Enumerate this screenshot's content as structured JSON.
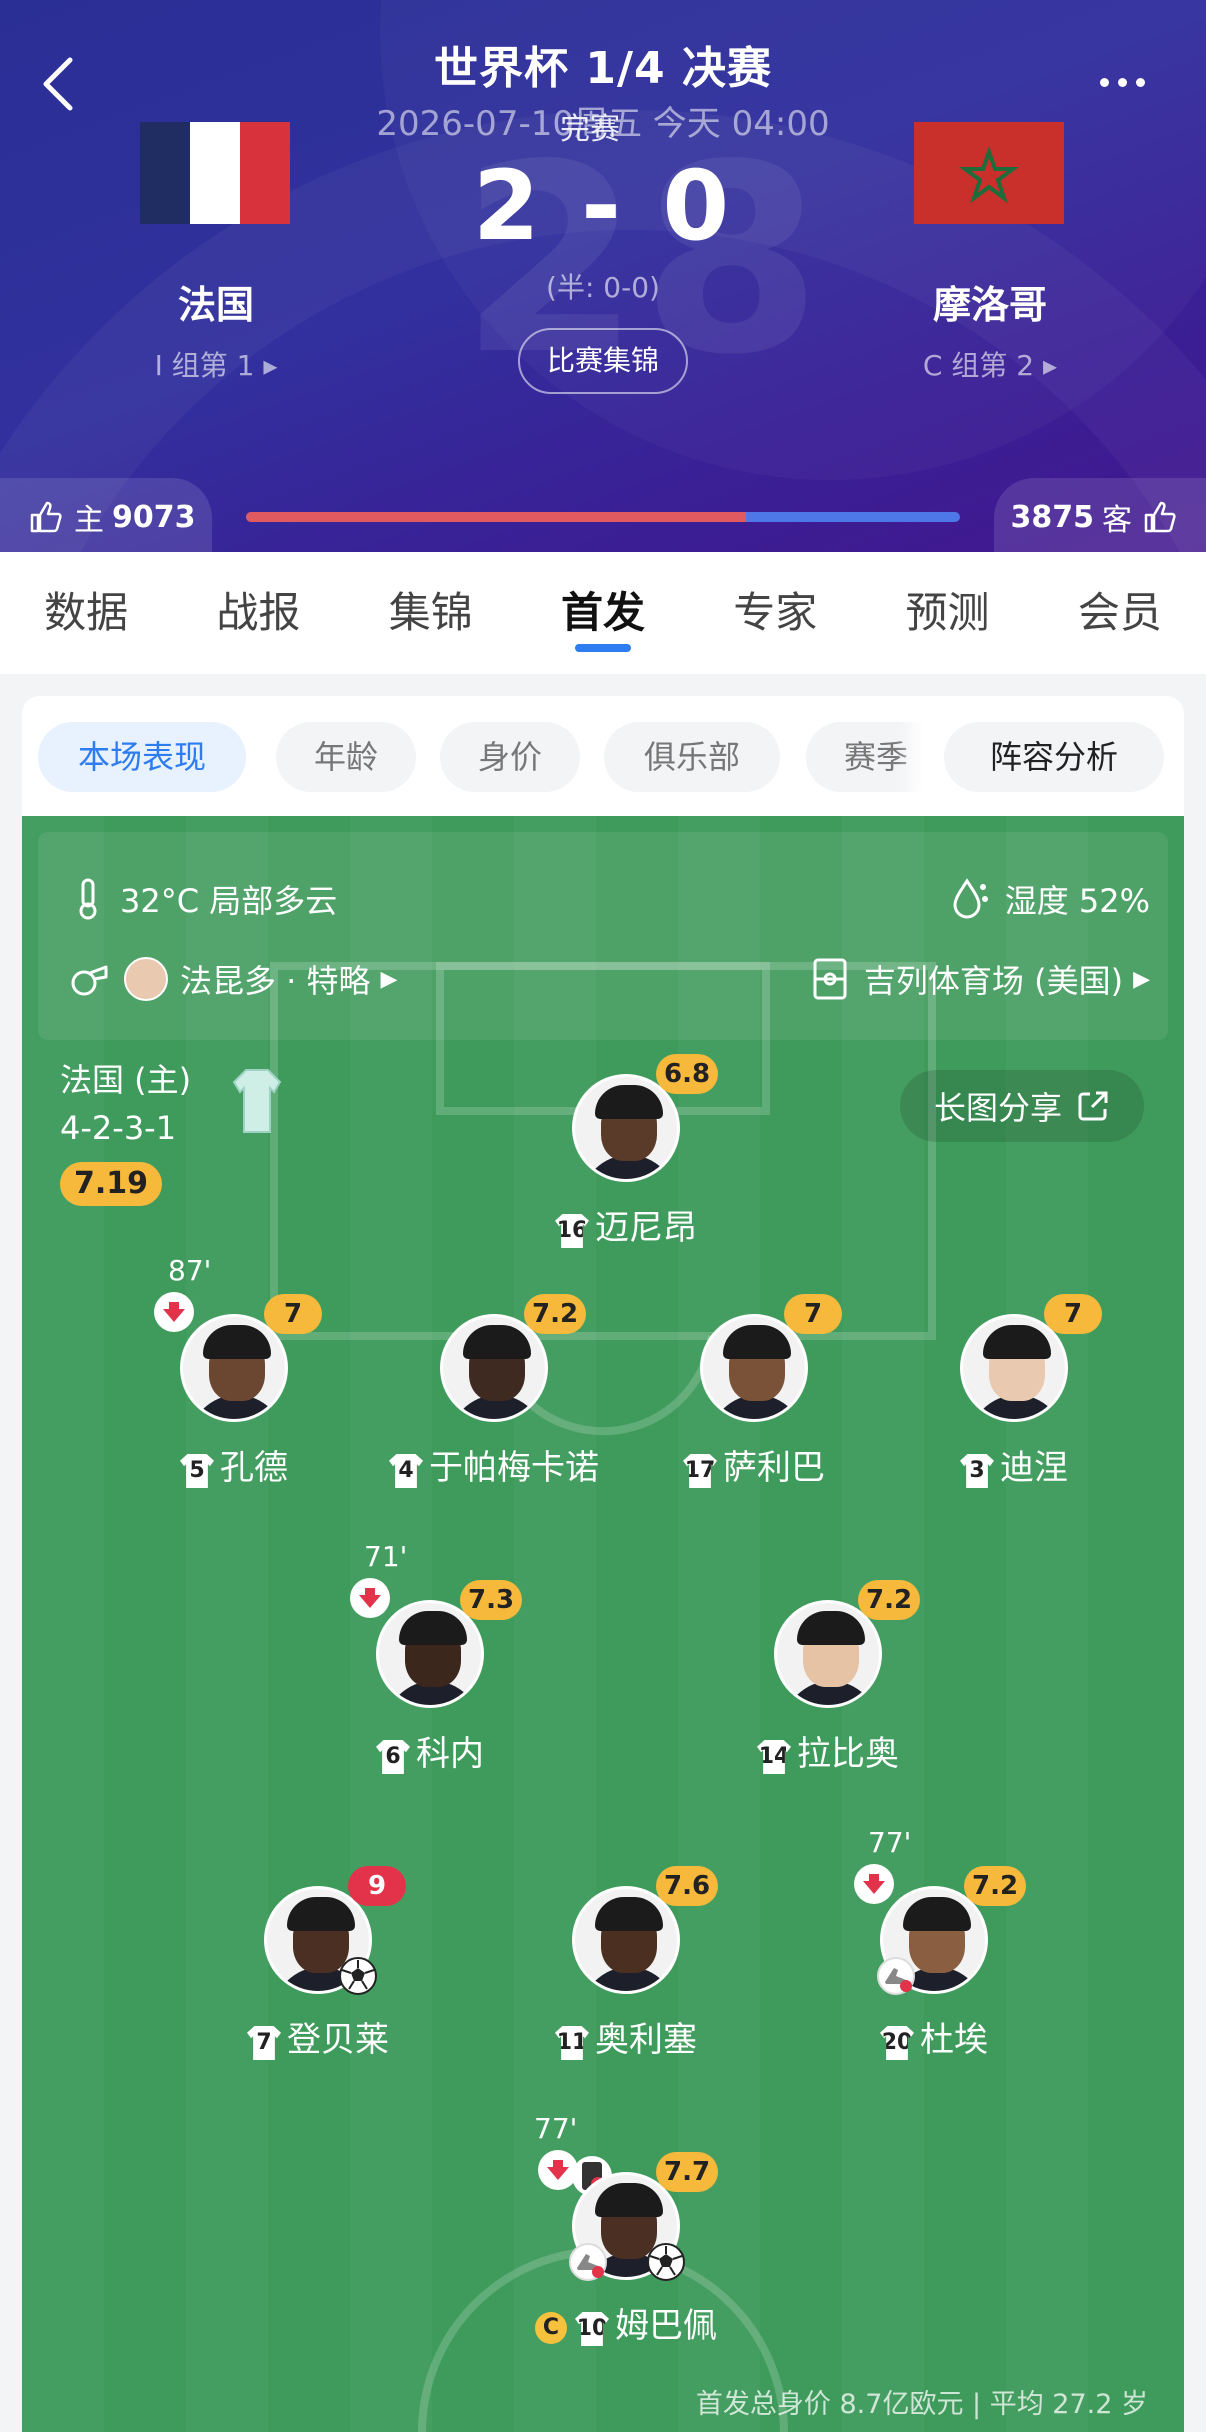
{
  "header": {
    "title": "世界杯 1/4 决赛",
    "datetime": "2026-07-10周五  今天 04:00",
    "status": "完赛",
    "score": "2 - 0",
    "halftime": "(半: 0-0)",
    "highlights_label": "比赛集锦",
    "home": {
      "name": "法国",
      "rank": "I 组第 1",
      "flag": "france-flag"
    },
    "away": {
      "name": "摩洛哥",
      "rank": "C 组第 2",
      "flag": "morocco-flag"
    }
  },
  "votes": {
    "home_label": "主",
    "home_count": "9073",
    "away_label": "客",
    "away_count": "3875",
    "home_share": 0.7,
    "home_color": "#e05a5f",
    "away_color": "#4e77e8"
  },
  "tabs": [
    "数据",
    "战报",
    "集锦",
    "首发",
    "专家",
    "预测",
    "会员"
  ],
  "active_tab": "首发",
  "chips": [
    "本场表现",
    "年龄",
    "身价",
    "俱乐部",
    "赛季"
  ],
  "analysis_chip": "阵容分析",
  "conditions": {
    "weather": "32°C 局部多云",
    "humidity": "湿度 52%",
    "referee": "法昆多 · 特略",
    "stadium": "吉列体育场 (美国)"
  },
  "lineup": {
    "team_line": "法国 (主)",
    "formation": "4-2-3-1",
    "team_rating": "7.19",
    "share_label": "长图分享"
  },
  "players": [
    {
      "num": "16",
      "name": "迈尼昂",
      "rating": "6.8",
      "sub": "",
      "skin": "#5a3a28"
    },
    {
      "num": "5",
      "name": "孔德",
      "rating": "7",
      "sub": "87'",
      "skin": "#6b4630"
    },
    {
      "num": "4",
      "name": "于帕梅卡诺",
      "rating": "7.2",
      "sub": "",
      "skin": "#3e2a20"
    },
    {
      "num": "17",
      "name": "萨利巴",
      "rating": "7",
      "sub": "",
      "skin": "#7a5238"
    },
    {
      "num": "3",
      "name": "迪涅",
      "rating": "7",
      "sub": "",
      "skin": "#e9c9b0"
    },
    {
      "num": "6",
      "name": "科内",
      "rating": "7.3",
      "sub": "71'",
      "skin": "#3b271c"
    },
    {
      "num": "14",
      "name": "拉比奥",
      "rating": "7.2",
      "sub": "",
      "skin": "#e6c3a5"
    },
    {
      "num": "7",
      "name": "登贝莱",
      "rating": "9",
      "sub": "",
      "skin": "#4a2f22"
    },
    {
      "num": "11",
      "name": "奥利塞",
      "rating": "7.6",
      "sub": "",
      "skin": "#4b3022"
    },
    {
      "num": "20",
      "name": "杜埃",
      "rating": "7.2",
      "sub": "77'",
      "skin": "#8a5e40"
    },
    {
      "num": "10",
      "name": "姆巴佩",
      "rating": "7.7",
      "sub": "77'",
      "skin": "#4a2f22"
    }
  ],
  "captain_label": "C",
  "footer": "首发总身价 8.7亿欧元  |  平均 27.2 岁"
}
